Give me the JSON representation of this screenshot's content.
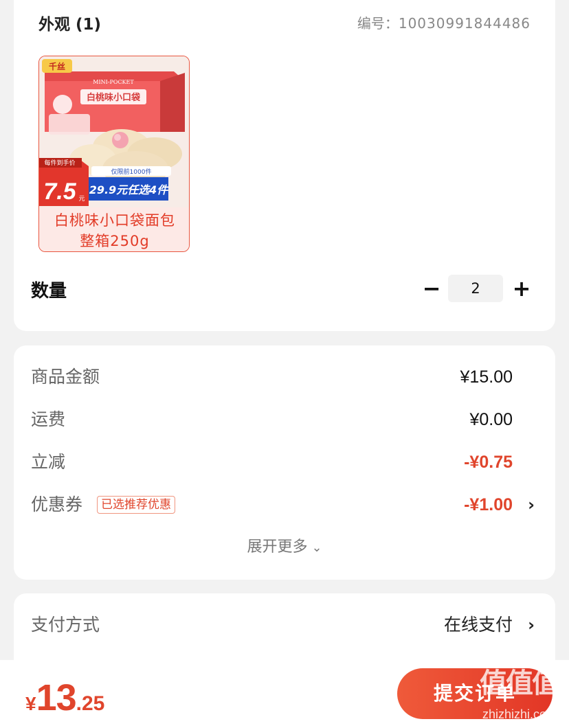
{
  "spec": {
    "heading": "外观 (1)",
    "sku_label": "编号：",
    "sku_value": "10030991844486"
  },
  "product": {
    "label_line1": "白桃味小口袋面包",
    "label_line2": "整箱250g",
    "image": {
      "brand_mark": "千丝",
      "box_sub": "MINI-POCKET",
      "box_title": "白桃味小口袋",
      "price_tag_top": "每件到手价",
      "price_main": "7.5",
      "price_unit": "元",
      "promo_top": "仅限前1000件",
      "promo_main": "29.9元任选4件"
    }
  },
  "quantity": {
    "label": "数量",
    "minus": "−",
    "value": "2",
    "plus": "+"
  },
  "price_rows": [
    {
      "label": "商品金额",
      "value": "¥15.00"
    },
    {
      "label": "运费",
      "value": "¥0.00"
    },
    {
      "label": "立减",
      "value": "-¥0.75"
    },
    {
      "label": "优惠券",
      "tag": "已选推荐优惠",
      "value": "-¥1.00",
      "chevron": "›"
    }
  ],
  "expand": {
    "label": "展开更多",
    "icon": "⌄"
  },
  "payment": {
    "label": "支付方式",
    "value": "在线支付",
    "chevron": "›"
  },
  "footer": {
    "currency": "¥",
    "total_int": "13",
    "total_dec": ".25",
    "submit": "提交订单"
  },
  "watermark": {
    "logo": "值值值",
    "url": "zhizhizhi.com"
  },
  "colors": {
    "accent": "#e0452c",
    "tile_border": "#e8553f",
    "tile_bg": "#fde9e6"
  }
}
